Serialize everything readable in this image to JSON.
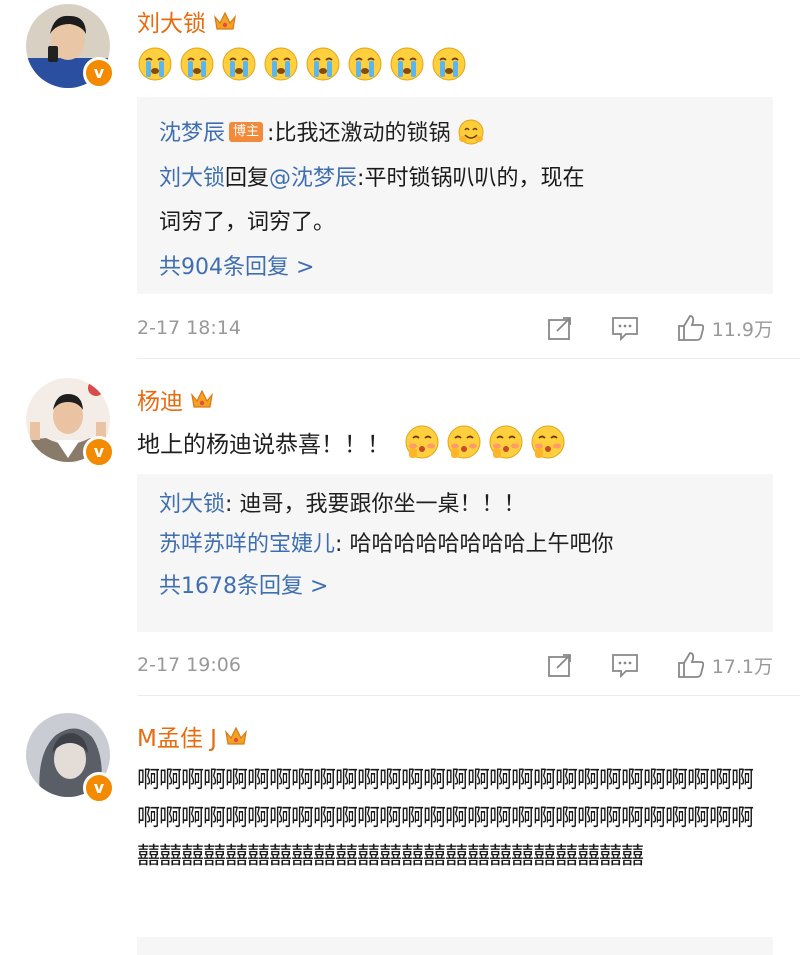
{
  "comments": [
    {
      "username": "刘大锁",
      "text": "",
      "emoji_count": 8,
      "emoji_name": "crying-face",
      "replies": [
        {
          "name": "沈梦辰",
          "tag": "博主",
          "sep": ":",
          "text": "比我还激动的锁锅"
        },
        {
          "name": "刘大锁",
          "connector": "回复",
          "target": "@沈梦辰",
          "text": ":平时锁锅叭叭的，现在词穷了，词穷了。"
        }
      ],
      "more": "共904条回复 >",
      "time": "2-17 18:14",
      "likes": "11.9万"
    },
    {
      "username": "杨迪",
      "text": "地上的杨迪说恭喜！！！",
      "emoji_name": "blowing-kiss-face",
      "emoji_count": 4,
      "replies": [
        {
          "name": "刘大锁",
          "sep": ":",
          "text": "迪哥，我要跟你坐一桌！！！"
        },
        {
          "name": "苏咩苏咩的宝婕儿",
          "sep": ":",
          "text": "哈哈哈哈哈哈哈哈上午吧你"
        }
      ],
      "more": "共1678条回复 >",
      "time": "2-17 19:06",
      "likes": "17.1万"
    },
    {
      "username": "M孟佳 J",
      "text": "啊啊啊啊啊啊啊啊啊啊啊啊啊啊啊啊啊啊啊啊啊啊啊啊啊啊啊啊啊啊啊啊啊啊啊啊啊啊啊啊啊啊啊啊啊啊啊啊啊啊啊啊啊啊啊啊 囍囍囍囍囍囍囍囍囍囍囍囍囍囍囍囍囍囍囍囍囍囍囍"
    }
  ],
  "colors": {
    "username": "#e86b0f",
    "reply_name": "#3f6fb1",
    "reply_bg": "#f6f6f6",
    "meta": "#999999",
    "badge": "#f38a00"
  }
}
